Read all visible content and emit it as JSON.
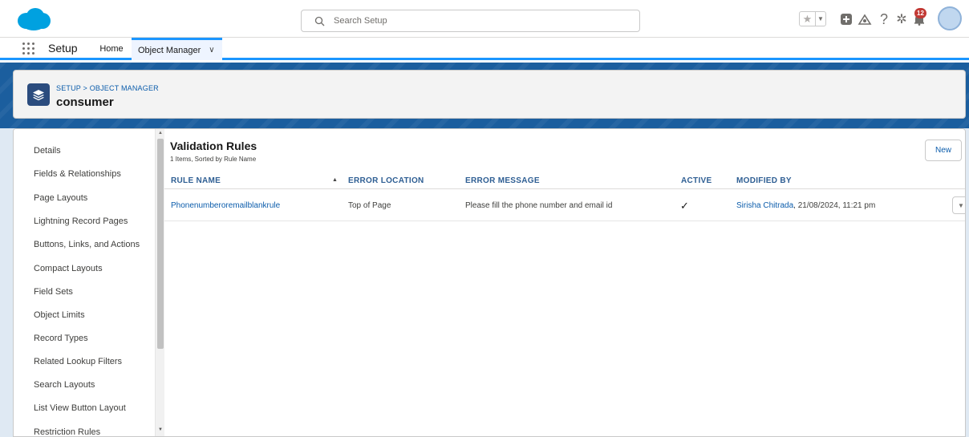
{
  "header": {
    "search_placeholder": "Search Setup",
    "notification_count": "12",
    "icons": [
      "salesforce-cloud-icon",
      "search-icon",
      "favorite-star-icon",
      "favorites-dropdown-icon",
      "global-add-icon",
      "trailhead-icon",
      "help-icon",
      "setup-gear-icon",
      "notification-bell-icon",
      "avatar"
    ]
  },
  "nav": {
    "app_name": "Setup",
    "tabs": [
      {
        "label": "Home"
      },
      {
        "label": "Object Manager",
        "active": true
      }
    ]
  },
  "page_header": {
    "breadcrumb": "SETUP > OBJECT MANAGER",
    "title": "consumer"
  },
  "sidebar": {
    "items": [
      "Details",
      "Fields & Relationships",
      "Page Layouts",
      "Lightning Record Pages",
      "Buttons, Links, and Actions",
      "Compact Layouts",
      "Field Sets",
      "Object Limits",
      "Record Types",
      "Related Lookup Filters",
      "Search Layouts",
      "List View Button Layout",
      "Restriction Rules"
    ]
  },
  "main": {
    "title": "Validation Rules",
    "subtitle": "1 Items, Sorted by Rule Name",
    "new_button": "New",
    "columns": [
      "RULE NAME",
      "ERROR LOCATION",
      "ERROR MESSAGE",
      "ACTIVE",
      "MODIFIED BY"
    ],
    "rows": [
      {
        "rule_name": "Phonenumberoremailblankrule",
        "error_location": "Top of Page",
        "error_message": "Please fill the phone number and email id",
        "active": true,
        "modified_by_name": "Sirisha Chitrada",
        "modified_by_date": ", 21/08/2024, 11:21 pm"
      }
    ]
  },
  "colors": {
    "brand_blue": "#0176d3",
    "link": "#0b5cab",
    "header_blue": "#1b5e9e",
    "badge_red": "#c23934"
  }
}
